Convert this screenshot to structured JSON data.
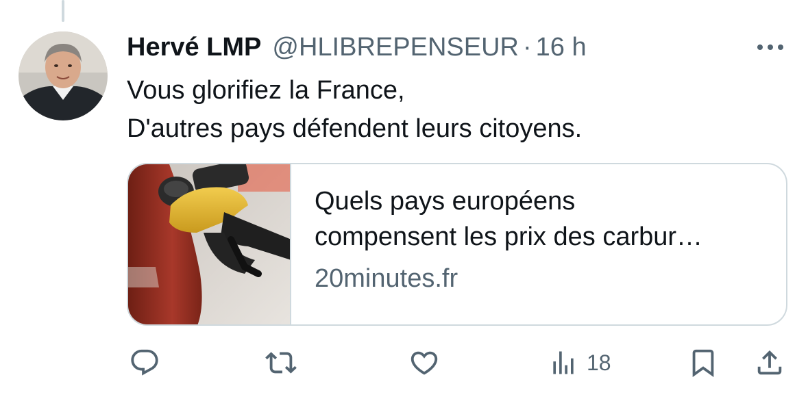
{
  "tweet": {
    "author_name": "Hervé LMP",
    "handle": "@HLIBREPENSEUR",
    "separator": "·",
    "time": "16 h",
    "text_lines": [
      "Vous glorifiez la France,",
      "D'autres pays défendent leurs citoyens."
    ]
  },
  "link_card": {
    "title_lines": [
      "Quels pays européens",
      "compensent les prix des carbur…"
    ],
    "domain": "20minutes.fr"
  },
  "actions": {
    "views_count": "18"
  },
  "icons": {
    "more": "more-horizontal-icon",
    "reply": "reply-icon",
    "retweet": "retweet-icon",
    "like": "like-icon",
    "views": "views-icon",
    "bookmark": "bookmark-icon",
    "share": "share-icon"
  },
  "colors": {
    "text_primary": "#0f1419",
    "text_secondary": "#536471",
    "border": "#cfd9de"
  }
}
